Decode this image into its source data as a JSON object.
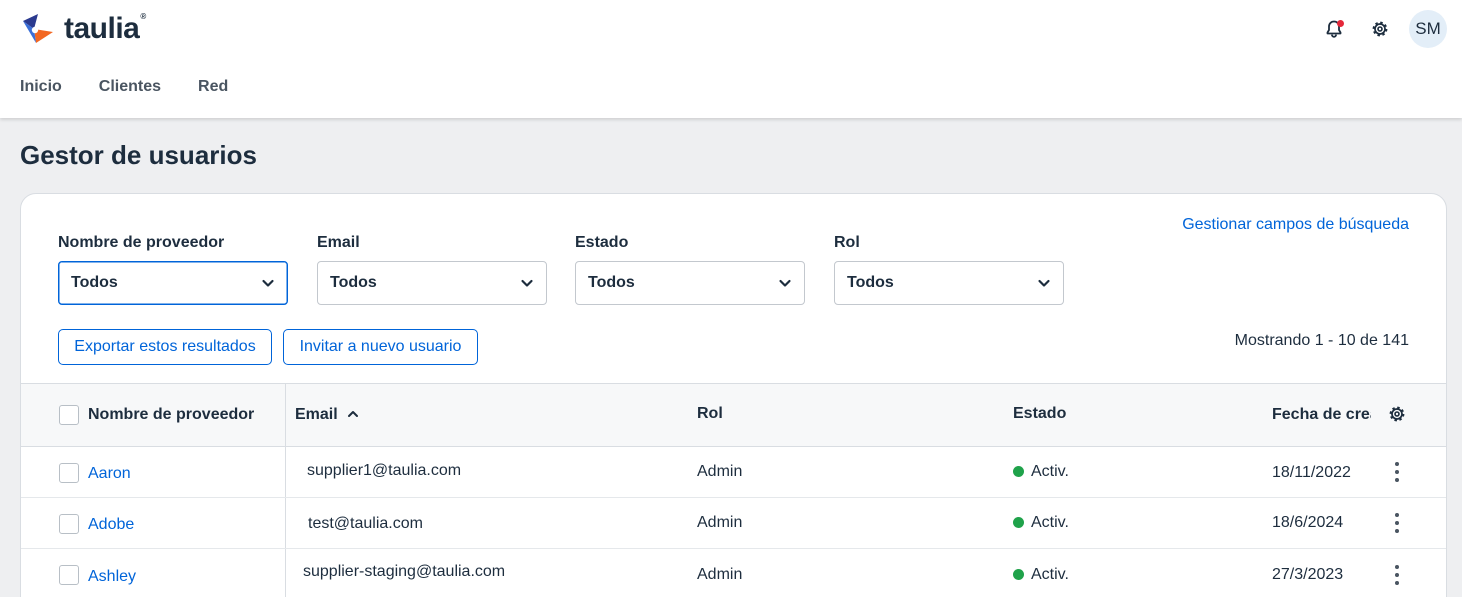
{
  "brand": {
    "name": "taulia",
    "tm": "®"
  },
  "header": {
    "avatar_initials": "SM"
  },
  "nav": {
    "items": [
      "Inicio",
      "Clientes",
      "Red"
    ]
  },
  "page": {
    "title": "Gestor de usuarios"
  },
  "filters": {
    "manage_link": "Gestionar campos de búsqueda",
    "items": [
      {
        "label": "Nombre de proveedor",
        "value": "Todos"
      },
      {
        "label": "Email",
        "value": "Todos"
      },
      {
        "label": "Estado",
        "value": "Todos"
      },
      {
        "label": "Rol",
        "value": "Todos"
      }
    ]
  },
  "actions": {
    "export": "Exportar estos resultados",
    "invite": "Invitar a nuevo usuario"
  },
  "pagination": {
    "showing": "Mostrando 1 - 10 de 141"
  },
  "table": {
    "headers": {
      "supplier": "Nombre de proveedor",
      "email": "Email",
      "role": "Rol",
      "status": "Estado",
      "created": "Fecha de creación"
    },
    "rows": [
      {
        "supplier": "Aaron",
        "email": "supplier1@taulia.com",
        "role": "Admin",
        "status": "Activ.",
        "created": "18/11/2022"
      },
      {
        "supplier": "Adobe",
        "email": "test@taulia.com",
        "role": "Admin",
        "status": "Activ.",
        "created": "18/6/2024"
      },
      {
        "supplier": "Ashley",
        "email": "supplier-staging@taulia.com",
        "role": "Admin",
        "status": "Activ.",
        "created": "27/3/2023"
      }
    ]
  },
  "colors": {
    "accent": "#0064d9",
    "status_active": "#1fa24a",
    "notification": "#e5283a"
  }
}
